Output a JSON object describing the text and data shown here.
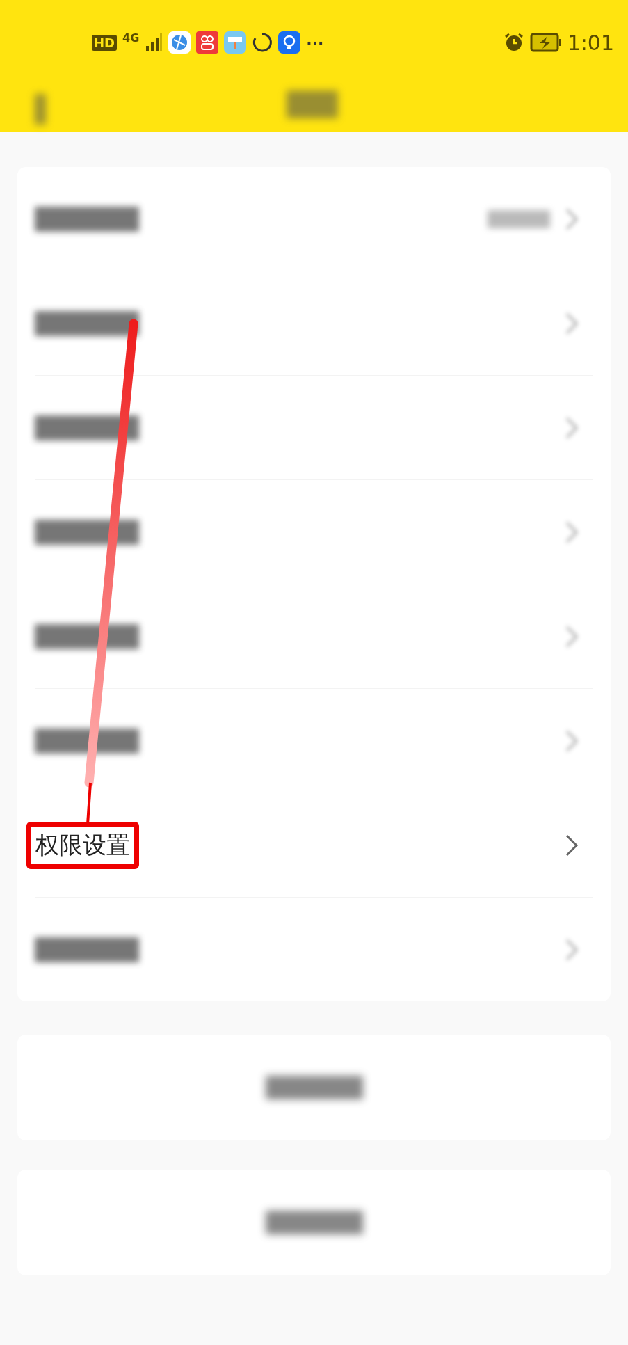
{
  "status_bar": {
    "hd": "HD",
    "network": "4G",
    "more": "···",
    "time": "1:01"
  },
  "header": {
    "kind": "blurred"
  },
  "rows": [
    {
      "kind": "blurred",
      "has_value": true,
      "highlighted": false
    },
    {
      "kind": "blurred",
      "has_value": false,
      "highlighted": false
    },
    {
      "kind": "blurred",
      "has_value": false,
      "highlighted": false
    },
    {
      "kind": "blurred",
      "has_value": false,
      "highlighted": false
    },
    {
      "kind": "blurred",
      "has_value": false,
      "highlighted": false
    },
    {
      "kind": "blurred",
      "has_value": false,
      "highlighted": false
    },
    {
      "kind": "text",
      "label": "权限设置",
      "has_value": false,
      "highlighted": true
    },
    {
      "kind": "blurred",
      "has_value": false,
      "highlighted": false
    }
  ],
  "buttons": [
    {
      "kind": "blurred"
    },
    {
      "kind": "blurred"
    }
  ]
}
